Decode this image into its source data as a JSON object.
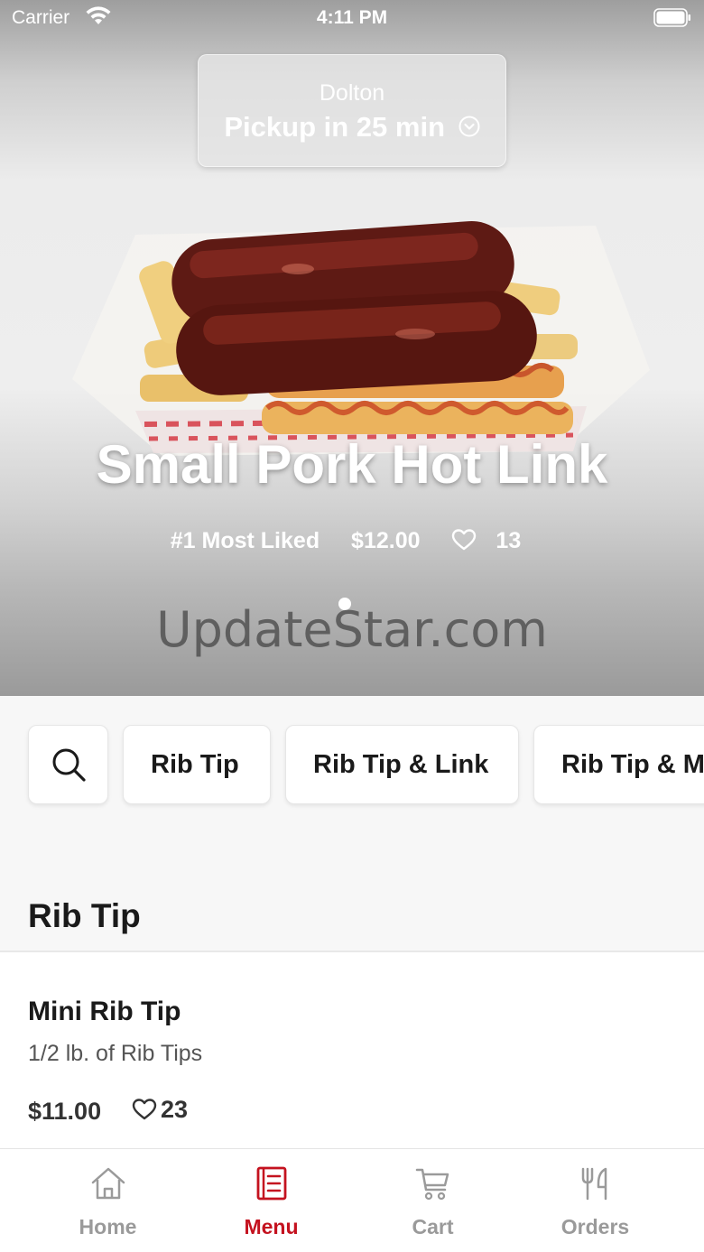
{
  "status_bar": {
    "carrier": "Carrier",
    "time": "4:11 PM"
  },
  "location": {
    "city": "Dolton",
    "pickup": "Pickup in 25 min"
  },
  "hero": {
    "title": "Small Pork Hot Link",
    "rank": "#1 Most Liked",
    "price": "$12.00",
    "likes": "13",
    "watermark": "UpdateStar.com"
  },
  "chips": [
    {
      "label": "Rib Tip"
    },
    {
      "label": "Rib Tip & Link"
    },
    {
      "label": "Rib Tip & Mini Link"
    }
  ],
  "section": {
    "title": "Rib Tip"
  },
  "items": [
    {
      "name": "Mini Rib Tip",
      "description": "1/2 lb. of Rib Tips",
      "price": "$11.00",
      "likes": "23"
    }
  ],
  "tabs": [
    {
      "label": "Home",
      "icon": "home-icon",
      "active": false
    },
    {
      "label": "Menu",
      "icon": "menu-icon",
      "active": true
    },
    {
      "label": "Cart",
      "icon": "cart-icon",
      "active": false
    },
    {
      "label": "Orders",
      "icon": "orders-icon",
      "active": false
    }
  ],
  "colors": {
    "accent": "#c4121f",
    "inactive": "#9a9a9a"
  }
}
